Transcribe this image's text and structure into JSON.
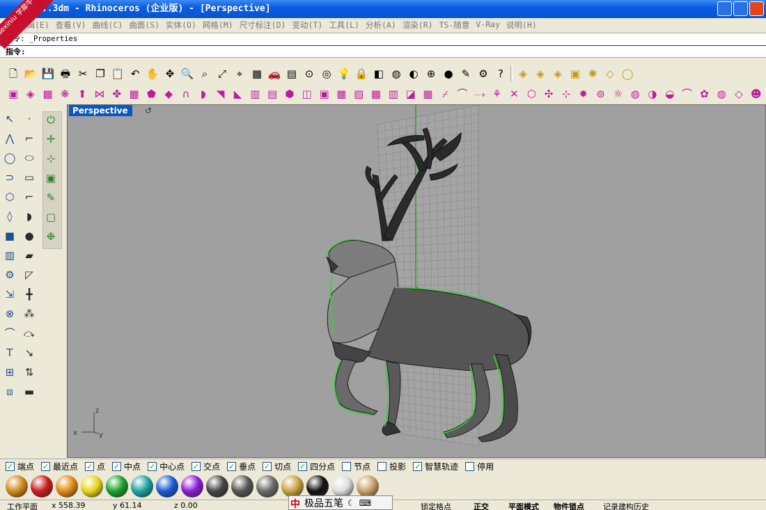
{
  "window": {
    "title": "..3dm - Rhinoceros (企业版) - [Perspective]",
    "watermark": "xuexiniu 学犀牛中文网"
  },
  "menu": [
    "编辑(E)",
    "查看(V)",
    "曲线(C)",
    "曲面(S)",
    "实体(O)",
    "网格(M)",
    "尺寸标注(D)",
    "变动(T)",
    "工具(L)",
    "分析(A)",
    "渲染(R)",
    "TS-随意",
    "V-Ray",
    "说明(H)"
  ],
  "command": {
    "history": "指令: _Properties",
    "prompt": "指令:"
  },
  "toolbar1": [
    "new-file-icon",
    "open-file-icon",
    "save-icon",
    "print-icon",
    "cut-icon",
    "copy-icon",
    "paste-icon",
    "undo-icon",
    "pan-hand-icon",
    "rotate-view-icon",
    "zoom-icon",
    "zoom-window-icon",
    "zoom-extents-icon",
    "zoom-selected-icon",
    "four-viewports-icon",
    "car-icon",
    "grid-plane-icon",
    "cplane-icon",
    "cplane-named-icon",
    "light-bulb-icon",
    "lock-icon",
    "layer-icon",
    "color-wheel-icon",
    "sphere-wire-icon",
    "sphere-grid-icon",
    "sphere-render-icon",
    "pencil-icon",
    "options-icon",
    "help-icon",
    "tsplines-1-icon",
    "tsplines-2-icon",
    "tsplines-3-icon",
    "tsplines-box-icon",
    "tsplines-star-icon",
    "tsplines-tag-icon",
    "tsplines-circle-icon"
  ],
  "toolbar2_count": 44,
  "viewport": {
    "name": "Perspective",
    "axis_z": "z",
    "axis_x": "x",
    "axis_y": "y"
  },
  "osnaps": [
    {
      "label": "端点",
      "checked": true
    },
    {
      "label": "最近点",
      "checked": true
    },
    {
      "label": "点",
      "checked": true
    },
    {
      "label": "中点",
      "checked": true
    },
    {
      "label": "中心点",
      "checked": true
    },
    {
      "label": "交点",
      "checked": true
    },
    {
      "label": "垂点",
      "checked": true
    },
    {
      "label": "切点",
      "checked": true
    },
    {
      "label": "四分点",
      "checked": true
    },
    {
      "label": "节点",
      "checked": false
    },
    {
      "label": "投影",
      "checked": false
    },
    {
      "label": "智慧轨迹",
      "checked": true
    },
    {
      "label": "停用",
      "checked": false
    }
  ],
  "materials": [
    "#d4881c",
    "#cc1a1a",
    "#e08a10",
    "#e6d41a",
    "#19a22a",
    "#1aa49e",
    "#1a5bd6",
    "#8e1ad6",
    "#444444",
    "#555555",
    "#6a6a6a",
    "#c8a23c",
    "#111111",
    "#dddddd",
    "#c9a066"
  ],
  "status": {
    "cplane": "工作平面",
    "x": "x 558.39",
    "y": "y 61.14",
    "z": "z 0.00",
    "ime": "极品五笔",
    "grid_snap": "锁定格点",
    "ortho": "正交",
    "planar": "平面模式",
    "osnap": "物件锁点",
    "history": "记录建构历史"
  }
}
